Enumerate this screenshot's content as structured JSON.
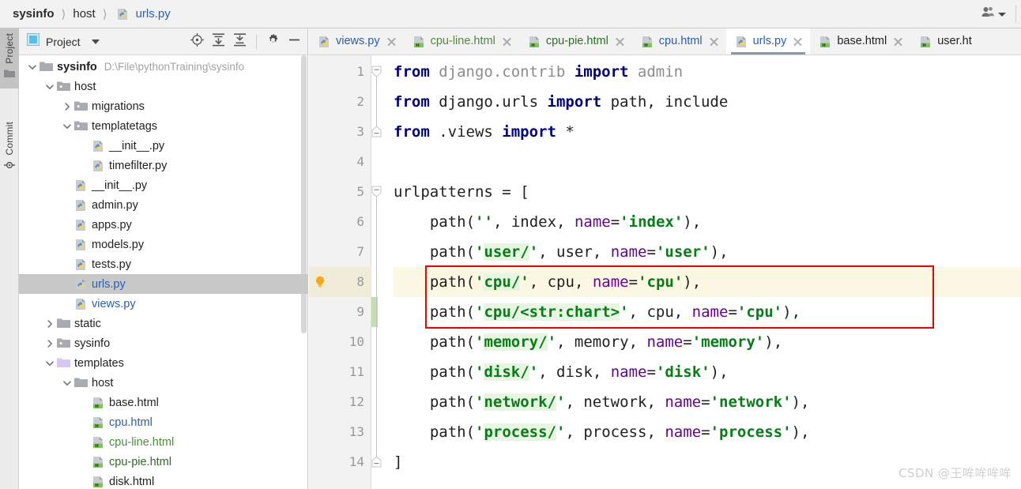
{
  "breadcrumb": {
    "items": [
      {
        "label": "sysinfo",
        "style": "bold"
      },
      {
        "label": "host",
        "style": "plain"
      },
      {
        "label": "urls.py",
        "style": "link",
        "icon": "python-file-icon"
      }
    ],
    "separator": "〉"
  },
  "titlebar": {
    "user_icon": "user-avatar-icon",
    "user_dropdown_icon": "chevron-down-icon"
  },
  "toolstrip": {
    "tabs": [
      {
        "label": "Project",
        "icon": "folder-icon",
        "active": true
      },
      {
        "label": "Commit",
        "icon": "commit-icon",
        "active": false
      }
    ]
  },
  "project_panel": {
    "title": "Project",
    "dropdown_icon": "chevron-down-icon",
    "actions": [
      {
        "name": "locate-icon",
        "tooltip": "Select Opened File"
      },
      {
        "name": "expand-all-icon",
        "tooltip": "Expand All"
      },
      {
        "name": "collapse-all-icon",
        "tooltip": "Collapse All"
      },
      {
        "name": "settings-gear-icon",
        "tooltip": "Settings"
      },
      {
        "name": "minimize-icon",
        "tooltip": "Hide"
      }
    ],
    "tree": [
      {
        "label": "sysinfo",
        "path": "D:\\File\\pythonTraining\\sysinfo",
        "indent": 0,
        "twisty": "expanded",
        "icon": "folder-module-icon",
        "kind": "folder",
        "style": "bold",
        "selected": false
      },
      {
        "label": "host",
        "path": "",
        "indent": 1,
        "twisty": "expanded",
        "icon": "folder-source-icon",
        "kind": "folder",
        "style": "plain",
        "selected": false
      },
      {
        "label": "migrations",
        "path": "",
        "indent": 2,
        "twisty": "collapsed",
        "icon": "folder-source-icon",
        "kind": "folder",
        "style": "plain",
        "selected": false
      },
      {
        "label": "templatetags",
        "path": "",
        "indent": 2,
        "twisty": "expanded",
        "icon": "folder-source-icon",
        "kind": "folder",
        "style": "plain",
        "selected": false
      },
      {
        "label": "__init__.py",
        "path": "",
        "indent": 3,
        "twisty": "none",
        "icon": "python-file-icon",
        "kind": "file",
        "style": "plain",
        "selected": false
      },
      {
        "label": "timefilter.py",
        "path": "",
        "indent": 3,
        "twisty": "none",
        "icon": "python-file-icon",
        "kind": "file",
        "style": "plain",
        "selected": false
      },
      {
        "label": "__init__.py",
        "path": "",
        "indent": 2,
        "twisty": "none",
        "icon": "python-file-icon",
        "kind": "file",
        "style": "plain",
        "selected": false
      },
      {
        "label": "admin.py",
        "path": "",
        "indent": 2,
        "twisty": "none",
        "icon": "python-file-icon",
        "kind": "file",
        "style": "plain",
        "selected": false
      },
      {
        "label": "apps.py",
        "path": "",
        "indent": 2,
        "twisty": "none",
        "icon": "python-file-icon",
        "kind": "file",
        "style": "plain",
        "selected": false
      },
      {
        "label": "models.py",
        "path": "",
        "indent": 2,
        "twisty": "none",
        "icon": "python-file-icon",
        "kind": "file",
        "style": "plain",
        "selected": false
      },
      {
        "label": "tests.py",
        "path": "",
        "indent": 2,
        "twisty": "none",
        "icon": "python-file-icon",
        "kind": "file",
        "style": "plain",
        "selected": false
      },
      {
        "label": "urls.py",
        "path": "",
        "indent": 2,
        "twisty": "none",
        "icon": "python-file-icon",
        "kind": "file",
        "style": "blue",
        "selected": true
      },
      {
        "label": "views.py",
        "path": "",
        "indent": 2,
        "twisty": "none",
        "icon": "python-file-icon",
        "kind": "file",
        "style": "blue",
        "selected": false
      },
      {
        "label": "static",
        "path": "",
        "indent": 1,
        "twisty": "collapsed",
        "icon": "folder-icon",
        "kind": "folder",
        "style": "plain",
        "selected": false
      },
      {
        "label": "sysinfo",
        "path": "",
        "indent": 1,
        "twisty": "collapsed",
        "icon": "folder-source-icon",
        "kind": "folder",
        "style": "plain",
        "selected": false
      },
      {
        "label": "templates",
        "path": "",
        "indent": 1,
        "twisty": "expanded",
        "icon": "folder-template-icon",
        "kind": "folder",
        "style": "plain",
        "selected": false
      },
      {
        "label": "host",
        "path": "",
        "indent": 2,
        "twisty": "expanded",
        "icon": "folder-icon",
        "kind": "folder",
        "style": "plain",
        "selected": false
      },
      {
        "label": "base.html",
        "path": "",
        "indent": 3,
        "twisty": "none",
        "icon": "html-file-icon",
        "kind": "file",
        "style": "plain",
        "selected": false
      },
      {
        "label": "cpu.html",
        "path": "",
        "indent": 3,
        "twisty": "none",
        "icon": "html-file-icon",
        "kind": "file",
        "style": "blue",
        "selected": false
      },
      {
        "label": "cpu-line.html",
        "path": "",
        "indent": 3,
        "twisty": "none",
        "icon": "html-file-icon",
        "kind": "file",
        "style": "green",
        "selected": false
      },
      {
        "label": "cpu-pie.html",
        "path": "",
        "indent": 3,
        "twisty": "none",
        "icon": "html-file-icon",
        "kind": "file",
        "style": "dgreen",
        "selected": false
      },
      {
        "label": "disk.html",
        "path": "",
        "indent": 3,
        "twisty": "none",
        "icon": "html-file-icon",
        "kind": "file",
        "style": "plain",
        "selected": false
      }
    ]
  },
  "editor": {
    "tabs": [
      {
        "label": "views.py",
        "icon": "python-file-icon",
        "style": "blue",
        "active": false,
        "closable": true
      },
      {
        "label": "cpu-line.html",
        "icon": "html-file-icon",
        "style": "green",
        "active": false,
        "closable": true
      },
      {
        "label": "cpu-pie.html",
        "icon": "html-file-icon",
        "style": "dgreen",
        "active": false,
        "closable": true
      },
      {
        "label": "cpu.html",
        "icon": "html-file-icon",
        "style": "blue",
        "active": false,
        "closable": true
      },
      {
        "label": "urls.py",
        "icon": "python-file-icon",
        "style": "blue",
        "active": true,
        "closable": true
      },
      {
        "label": "base.html",
        "icon": "html-file-icon",
        "style": "black",
        "active": false,
        "closable": true
      },
      {
        "label": "user.ht",
        "icon": "html-file-icon",
        "style": "black",
        "active": false,
        "closable": false
      }
    ],
    "language": "python",
    "filename": "urls.py",
    "current_line": 8,
    "line_numbers": [
      1,
      2,
      3,
      4,
      5,
      6,
      7,
      8,
      9,
      10,
      11,
      12,
      13,
      14
    ],
    "gutter_icons": [
      {
        "line": 8,
        "name": "intention-bulb-icon"
      }
    ],
    "change_markers": [
      {
        "line": 9,
        "color": "#c5dfb3"
      }
    ],
    "annotation": {
      "name": "red-highlight-rectangle",
      "color": "#ee0000",
      "covers_lines": [
        8,
        9
      ]
    },
    "code": [
      {
        "n": 1,
        "fold": "open",
        "text": "from django.contrib import admin"
      },
      {
        "n": 2,
        "fold": "none",
        "text": "from django.urls import path, include"
      },
      {
        "n": 3,
        "fold": "close",
        "text": "from .views import *"
      },
      {
        "n": 4,
        "fold": "none",
        "text": ""
      },
      {
        "n": 5,
        "fold": "open",
        "text": "urlpatterns = ["
      },
      {
        "n": 6,
        "fold": "none",
        "text": "    path('', index, name='index'),"
      },
      {
        "n": 7,
        "fold": "none",
        "text": "    path('user/', user, name='user'),"
      },
      {
        "n": 8,
        "fold": "none",
        "text": "    path('cpu/', cpu, name='cpu'),"
      },
      {
        "n": 9,
        "fold": "none",
        "text": "    path('cpu/<str:chart>', cpu, name='cpu'),"
      },
      {
        "n": 10,
        "fold": "none",
        "text": "    path('memory/', memory, name='memory'),"
      },
      {
        "n": 11,
        "fold": "none",
        "text": "    path('disk/', disk, name='disk'),"
      },
      {
        "n": 12,
        "fold": "none",
        "text": "    path('network/', network, name='network'),"
      },
      {
        "n": 13,
        "fold": "none",
        "text": "    path('process/', process, name='process'),"
      },
      {
        "n": 14,
        "fold": "close",
        "text": "]"
      }
    ]
  },
  "watermark": "CSDN @王哞哞哞哞",
  "colors": {
    "keyword": "#000080",
    "string": "#067d17",
    "kwarg": "#660099",
    "module": "#8c8c8c",
    "string_highlight": "#e8f5e2",
    "current_line": "#fdf8e3",
    "annotation": "#ee0000",
    "selection": "#c8c8c8",
    "link": "#2a5db0"
  }
}
